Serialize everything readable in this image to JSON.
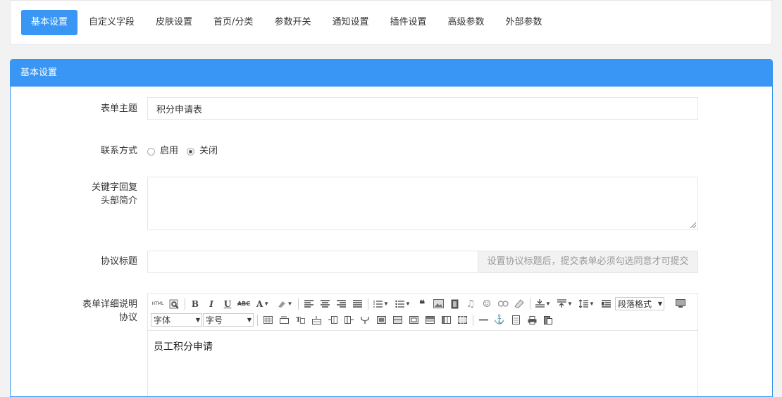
{
  "tabs": [
    {
      "label": "基本设置",
      "active": true
    },
    {
      "label": "自定义字段",
      "active": false
    },
    {
      "label": "皮肤设置",
      "active": false
    },
    {
      "label": "首页/分类",
      "active": false
    },
    {
      "label": "参数开关",
      "active": false
    },
    {
      "label": "通知设置",
      "active": false
    },
    {
      "label": "插件设置",
      "active": false
    },
    {
      "label": "高级参数",
      "active": false
    },
    {
      "label": "外部参数",
      "active": false
    }
  ],
  "panel": {
    "title": "基本设置"
  },
  "form": {
    "subject": {
      "label": "表单主题",
      "value": "积分申请表"
    },
    "contact": {
      "label": "联系方式",
      "options": [
        {
          "label": "启用",
          "checked": false
        },
        {
          "label": "关闭",
          "checked": true
        }
      ]
    },
    "keyword": {
      "label_line1": "关键字回复",
      "label_line2": "头部简介",
      "value": ""
    },
    "agreement_title": {
      "label": "协议标题",
      "value": "",
      "addon": "设置协议标题后，提交表单必须勾选同意才可提交"
    },
    "agreement": {
      "label_line1": "表单详细说明",
      "label_line2": "协议",
      "content": "员工积分申请"
    }
  },
  "editor": {
    "html_label": "HTML",
    "paragraph_format": "段落格式",
    "font_family": "字体",
    "font_size": "字号"
  },
  "colors": {
    "accent": "#3a96f4"
  }
}
